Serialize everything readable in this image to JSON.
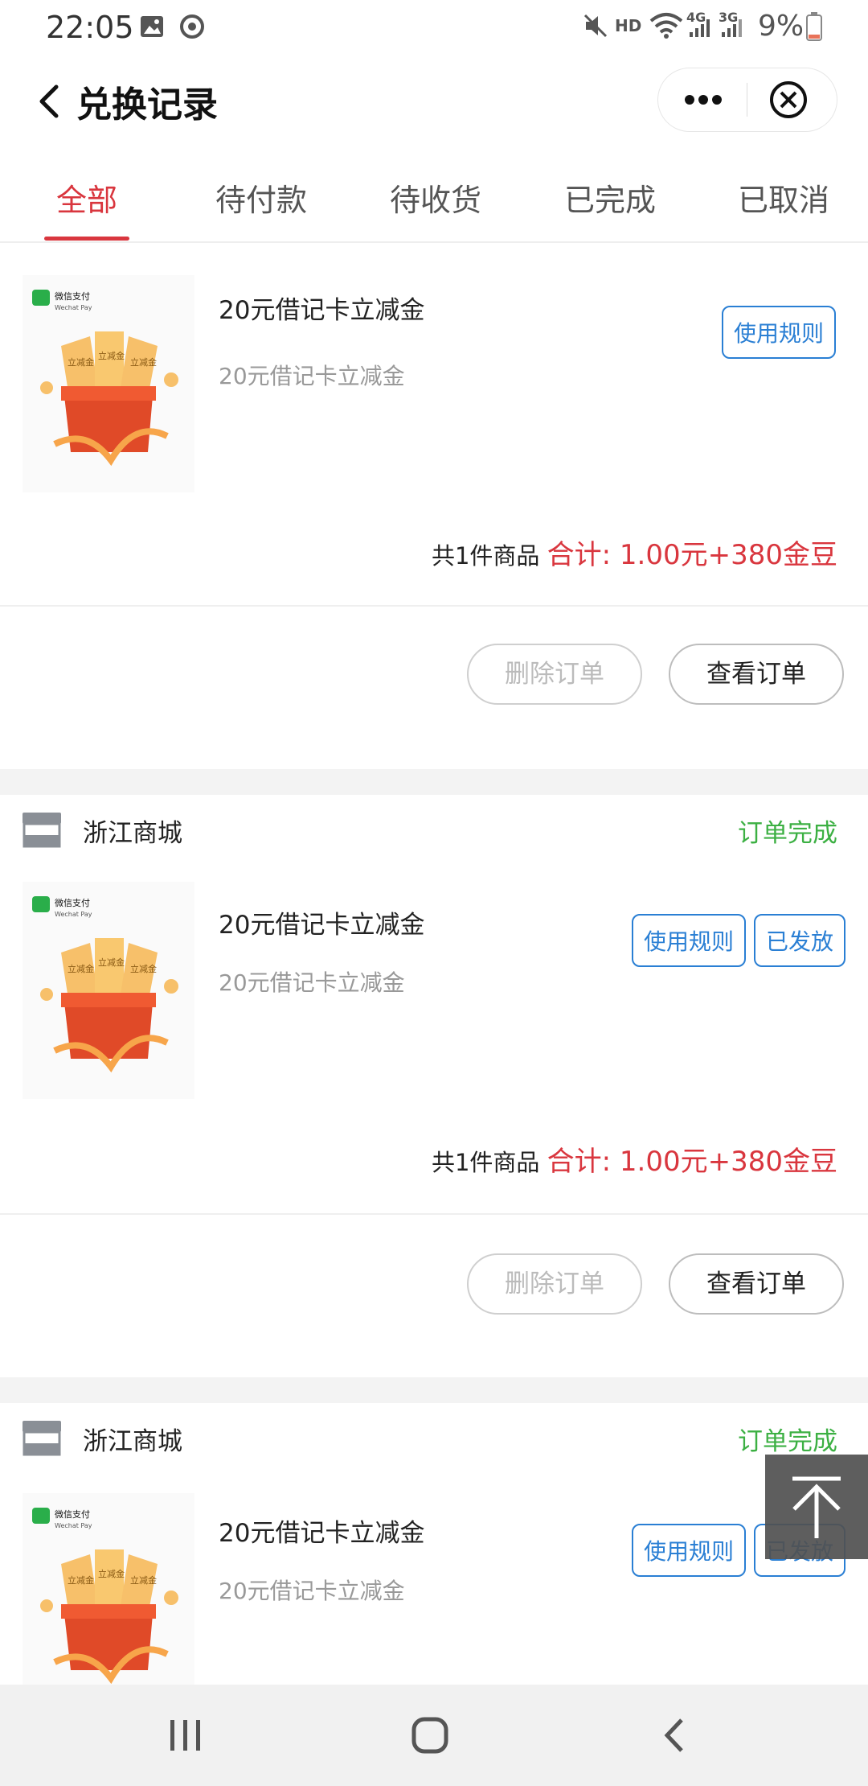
{
  "status_bar": {
    "time": "22:05",
    "signal_4g": "4G",
    "signal_3g": "3G",
    "hd": "HD",
    "battery": "9%",
    "icons": [
      "image-icon",
      "sync-icon",
      "mute-icon",
      "wifi-icon",
      "signal-icon",
      "battery-icon"
    ]
  },
  "header": {
    "title": "兑换记录",
    "back_icon": "chevron-left-icon",
    "more_icon": "more-dots-icon",
    "close_icon": "close-circle-icon"
  },
  "tabs": [
    {
      "label": "全部",
      "active": true
    },
    {
      "label": "待付款",
      "active": false
    },
    {
      "label": "待收货",
      "active": false
    },
    {
      "label": "已完成",
      "active": false
    },
    {
      "label": "已取消",
      "active": false
    }
  ],
  "orders": [
    {
      "store_name": "",
      "status": "",
      "product_name": "20元借记卡立减金",
      "product_sub": "20元借记卡立减金",
      "thumb_brand": "微信支付",
      "thumb_brand_en": "Wechat Pay",
      "buttons": [
        "使用规则"
      ],
      "summary_count": "共1件商品",
      "summary_total": "合计: 1.00元+380金豆",
      "actions": {
        "delete": "删除订单",
        "view": "查看订单"
      }
    },
    {
      "store_name": "浙江商城",
      "status": "订单完成",
      "product_name": "20元借记卡立减金",
      "product_sub": "20元借记卡立减金",
      "thumb_brand": "微信支付",
      "thumb_brand_en": "Wechat Pay",
      "buttons": [
        "使用规则",
        "已发放"
      ],
      "summary_count": "共1件商品",
      "summary_total": "合计: 1.00元+380金豆",
      "actions": {
        "delete": "删除订单",
        "view": "查看订单"
      }
    },
    {
      "store_name": "浙江商城",
      "status": "订单完成",
      "product_name": "20元借记卡立减金",
      "product_sub": "20元借记卡立减金",
      "thumb_brand": "微信支付",
      "thumb_brand_en": "Wechat Pay",
      "buttons": [
        "使用规则",
        "已发放"
      ]
    }
  ],
  "thumb_labels": [
    "立减金",
    "立减金",
    "立减金"
  ],
  "colors": {
    "accent_red": "#d9363e",
    "status_green": "#3cb043",
    "button_blue": "#2a7fd4"
  },
  "floating": {
    "back_to_top_icon": "arrow-up-to-top-icon"
  },
  "nav_bar": {
    "icons": [
      "recent-apps-icon",
      "home-icon",
      "back-icon"
    ]
  }
}
